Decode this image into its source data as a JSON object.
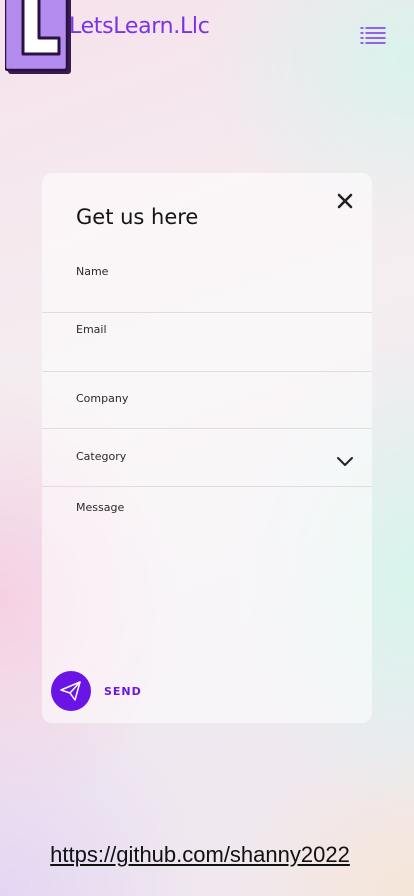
{
  "header": {
    "logo_icon": "letter-l-logo",
    "brand_name": "LetsLearn.Llc",
    "menu_icon": "list-menu-icon"
  },
  "colors": {
    "accent": "#6a14e6",
    "brand": "#7b33e6",
    "logo_fill": "#b48cf0"
  },
  "form": {
    "title": "Get us here",
    "close_icon": "close-icon",
    "fields": {
      "name": {
        "label": "Name",
        "value": ""
      },
      "email": {
        "label": "Email",
        "value": ""
      },
      "company": {
        "label": "Company",
        "value": ""
      },
      "category": {
        "label": "Category",
        "value": "",
        "icon": "chevron-down-icon"
      },
      "message": {
        "label": "Message",
        "value": ""
      }
    },
    "send_label": "SEND",
    "send_icon": "paper-plane-icon"
  },
  "footer": {
    "link_text": "https://github.com/shanny2022"
  }
}
